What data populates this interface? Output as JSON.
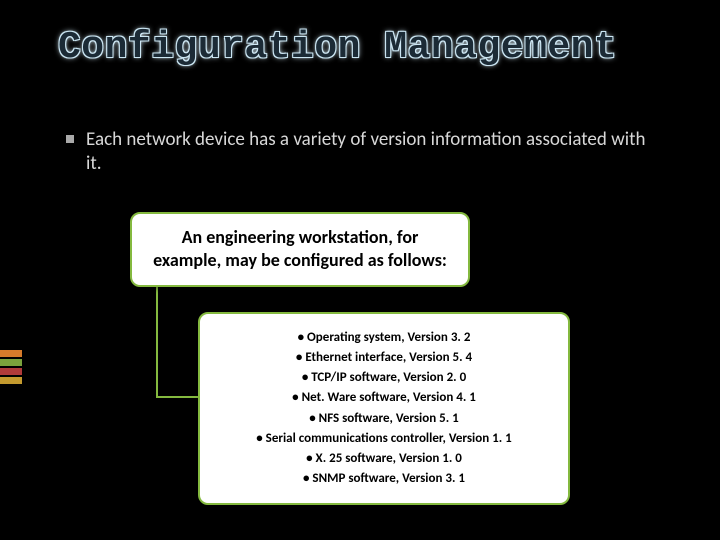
{
  "title": "Configuration Management",
  "bullet": "Each network device has a variety of version information associated with it.",
  "box1": "An engineering workstation, for example, may be configured as follows:",
  "items": [
    "• Operating system, Version 3. 2",
    "• Ethernet interface, Version 5. 4",
    "• TCP/IP software, Version 2. 0",
    "• Net. Ware software, Version 4. 1",
    "• NFS software, Version 5. 1",
    "• Serial communications controller, Version 1. 1",
    "• X. 25 software, Version 1. 0",
    "• SNMP software, Version 3. 1"
  ],
  "accent_colors": [
    "#d77b2b",
    "#7aa23c",
    "#b03a3a",
    "#c49a2e"
  ]
}
